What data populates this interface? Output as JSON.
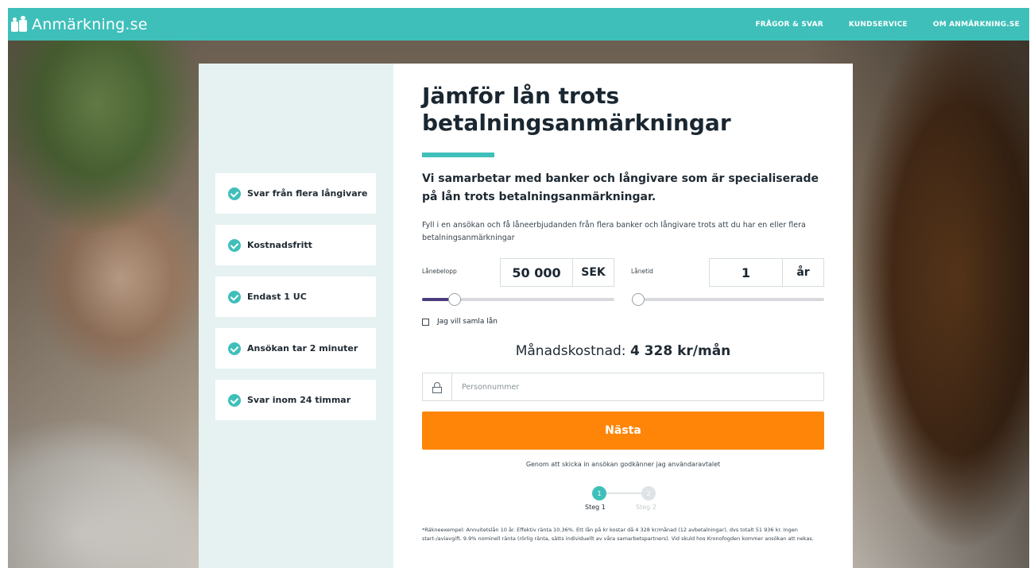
{
  "header": {
    "brand": "Anmärkning.se",
    "nav": [
      "FRÅGOR & SVAR",
      "KUNDSERVICE",
      "OM ANMÄRKNING.SE"
    ]
  },
  "features": [
    "Svar från flera långivare",
    "Kostnadsfritt",
    "Endast 1 UC",
    "Ansökan tar 2 minuter",
    "Svar inom 24 timmar"
  ],
  "form": {
    "title": "Jämför lån trots betalningsanmärkningar",
    "subtitle": "Vi samarbetar med banker och långivare som är specialiserade på lån trots betalningsanmärkningar.",
    "description": "Fyll i en ansökan och få låneerbjudanden från flera banker och långivare trots att du har en eller flera betalningsanmärkningar",
    "loan_amount_label": "Lånebelopp",
    "loan_amount_value": "50 000",
    "loan_amount_unit": "SEK",
    "loan_amount_level": 0.17,
    "loan_term_label": "Lånetid",
    "loan_term_value": "1",
    "loan_term_unit": "år",
    "loan_term_level": 0.0,
    "consolidate_label": "Jag vill samla lån",
    "monthly_label": "Månadskostnad:",
    "monthly_value": "4 328 kr/mån",
    "personnummer_placeholder": "Personnummer",
    "next_button": "Nästa",
    "consent": "Genom att skicka in ansökan godkänner jag användaravtalet",
    "steps": [
      {
        "number": "1",
        "label": "Steg 1",
        "active": true
      },
      {
        "number": "2",
        "label": "Steg 2",
        "active": false
      }
    ],
    "footnote": "*Räkneexempel: Annuitetslån 10 år. Effektiv ränta 10.36%. Ett lån på kr kostar då 4 328 kr/månad (12 avbetalningar), dvs totalt 51 936 kr. Ingen start-/aviavgift. 9.9% nominell ränta (rörlig ränta, sätts individuellt av våra samarbetspartners). Vid skuld hos Kronofogden kommer ansökan att nekas."
  },
  "colors": {
    "brand": "#3fbfba",
    "cta": "#ff8508",
    "slider_fill": "#4a3c7d"
  }
}
